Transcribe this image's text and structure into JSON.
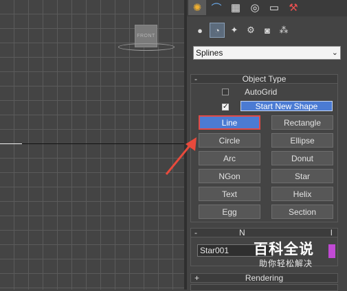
{
  "viewport": {
    "viewcube_label": "FRONT"
  },
  "command_panel": {
    "tabs": [
      {
        "name": "create-tab",
        "icon": "sun-icon",
        "glyph": "✺"
      },
      {
        "name": "modify-tab",
        "icon": "curve-icon",
        "glyph": "⌒"
      },
      {
        "name": "hierarchy-tab",
        "icon": "hierarchy-icon",
        "glyph": "▦"
      },
      {
        "name": "motion-tab",
        "icon": "motion-icon",
        "glyph": "◎"
      },
      {
        "name": "display-tab",
        "icon": "monitor-icon",
        "glyph": "▭"
      },
      {
        "name": "utilities-tab",
        "icon": "hammer-icon",
        "glyph": "⚒"
      }
    ],
    "categories": [
      {
        "name": "geometry",
        "icon": "sphere-icon",
        "glyph": "●"
      },
      {
        "name": "shapes",
        "icon": "shapes-icon",
        "glyph": "◔"
      },
      {
        "name": "lights",
        "icon": "light-icon",
        "glyph": "✦"
      },
      {
        "name": "cameras",
        "icon": "camera-icon",
        "glyph": "⚙"
      },
      {
        "name": "helpers",
        "icon": "helper-icon",
        "glyph": "◙"
      },
      {
        "name": "space-warps",
        "icon": "spacewarp-icon",
        "glyph": "⁂"
      }
    ],
    "dropdown_value": "Splines",
    "object_type": {
      "title": "Object Type",
      "collapse_sign": "-",
      "autogrid_label": "AutoGrid",
      "start_new_shape_label": "Start New Shape",
      "buttons": [
        "Line",
        "Rectangle",
        "Circle",
        "Ellipse",
        "Arc",
        "Donut",
        "NGon",
        "Star",
        "Text",
        "Helix",
        "Egg",
        "Section"
      ]
    },
    "name_color": {
      "title_visible": "N",
      "title_tail": "l",
      "collapse_sign": "-",
      "name_value": "Star001",
      "swatch_color": "#c14ad4"
    },
    "rendering": {
      "title": "Rendering",
      "expand_sign": "+"
    }
  },
  "watermark": {
    "logo": "百科全说",
    "subtitle": "助你轻松解决"
  },
  "colors": {
    "accent": "#4b7bd3",
    "highlight": "#e24a46"
  }
}
